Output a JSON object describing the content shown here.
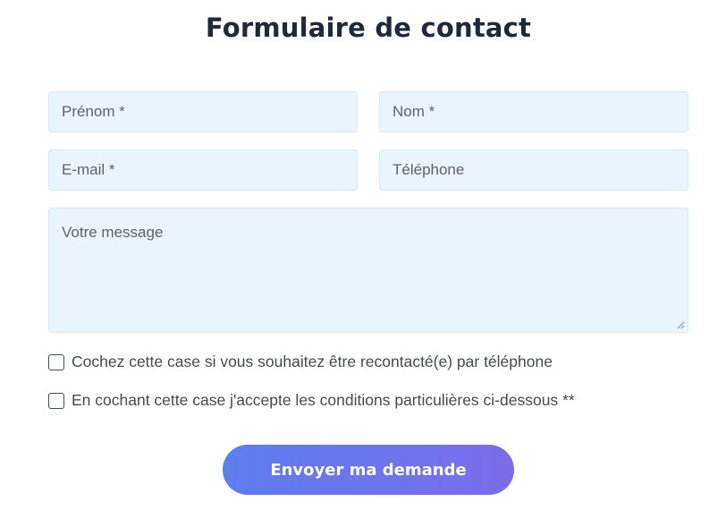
{
  "form": {
    "title": "Formulaire de contact",
    "fields": {
      "prenom_placeholder": "Prénom *",
      "nom_placeholder": "Nom *",
      "email_placeholder": "E-mail *",
      "telephone_placeholder": "Téléphone",
      "message_placeholder": "Votre message"
    },
    "checkboxes": {
      "callback_label": "Cochez cette case si vous souhaitez être recontacté(e) par téléphone",
      "terms_label": "En cochant cette case j'accepte les conditions particulières ci-dessous **"
    },
    "submit_label": "Envoyer ma demande"
  },
  "colors": {
    "field_background": "#eaf4fd",
    "button_gradient_start": "#5b7ef0",
    "button_gradient_end": "#7d6cea",
    "title_text": "#1f2937"
  }
}
